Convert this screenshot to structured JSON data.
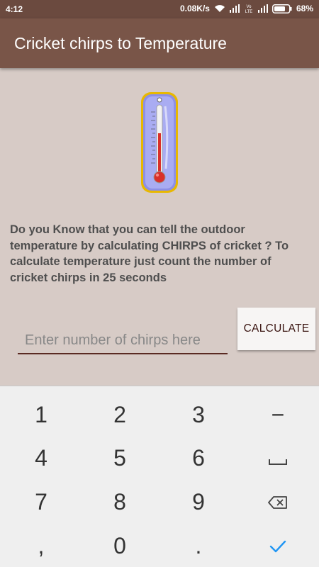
{
  "status_bar": {
    "time": "4:12",
    "net_speed": "0.08K/s",
    "volte_label": "VoLTE",
    "battery_percent": "68%"
  },
  "app_bar": {
    "title": "Cricket chirps to Temperature"
  },
  "content": {
    "info_text": "Do you Know that you can tell the outdoor temperature by calculating CHIRPS of cricket ? To calculate temperature just count the number of cricket chirps in 25 seconds",
    "chirps_input": {
      "value": "",
      "placeholder": "Enter number of chirps here"
    },
    "calculate_label": "CALCULATE"
  },
  "keyboard": {
    "keys": {
      "k1": "1",
      "k2": "2",
      "k3": "3",
      "minus": "−",
      "k4": "4",
      "k5": "5",
      "k6": "6",
      "k7": "7",
      "k8": "8",
      "k9": "9",
      "comma": ",",
      "k0": "0",
      "period": "."
    },
    "icons": {
      "space": "space-bar-icon",
      "backspace": "backspace-icon",
      "done": "checkmark-icon"
    }
  },
  "colors": {
    "status_bar": "#6b4a3f",
    "app_bar": "#795548",
    "background": "#d7cbc6",
    "input_underline": "#5a2a22",
    "checkmark": "#2196f3"
  }
}
